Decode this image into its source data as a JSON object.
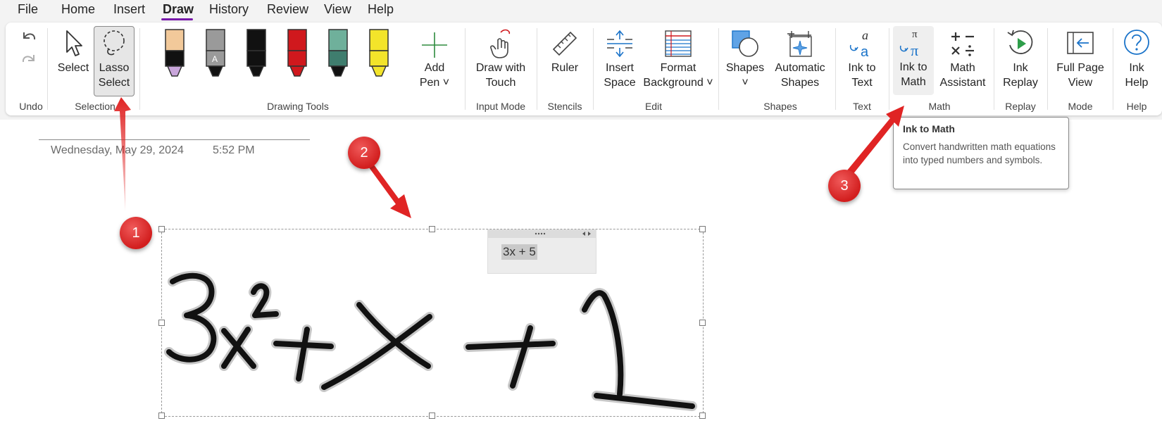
{
  "menu": {
    "items": [
      "File",
      "Home",
      "Insert",
      "Draw",
      "History",
      "Review",
      "View",
      "Help"
    ],
    "active": "Draw"
  },
  "ribbon": {
    "groups": {
      "undo": "Undo",
      "selection": "Selection",
      "drawing_tools": "Drawing Tools",
      "input_mode": "Input Mode",
      "stencils": "Stencils",
      "edit": "Edit",
      "shapes": "Shapes",
      "text": "Text",
      "math": "Math",
      "replay": "Replay",
      "mode": "Mode",
      "help": "Help"
    },
    "buttons": {
      "select": "Select",
      "lasso_1": "Lasso",
      "lasso_2": "Select",
      "add_pen_1": "Add",
      "add_pen_2": "Pen ˅",
      "draw_touch_1": "Draw with",
      "draw_touch_2": "Touch",
      "ruler": "Ruler",
      "insert_space_1": "Insert",
      "insert_space_2": "Space",
      "format_bg_1": "Format",
      "format_bg_2": "Background ˅",
      "shapes_1": "Shapes",
      "shapes_2": "˅",
      "auto_shapes_1": "Automatic",
      "auto_shapes_2": "Shapes",
      "ink_text_1": "Ink to",
      "ink_text_2": "Text",
      "ink_math_1": "Ink to",
      "ink_math_2": "Math",
      "math_assist_1": "Math",
      "math_assist_2": "Assistant",
      "ink_replay_1": "Ink",
      "ink_replay_2": "Replay",
      "full_page_1": "Full Page",
      "full_page_2": "View",
      "ink_help_1": "Ink",
      "ink_help_2": "Help"
    },
    "pens": [
      {
        "body": "#111111",
        "tip": "#f2c99a",
        "base": "#c9a6db"
      },
      {
        "body": "#9a9a9a",
        "tip": "#9a9a9a",
        "base": "#111111",
        "badge": "A"
      },
      {
        "body": "#111111",
        "tip": "#111111",
        "base": "#111111"
      },
      {
        "body": "#d0181d",
        "tip": "#d0181d",
        "base": "#d0181d"
      },
      {
        "body": "#3f7d6e",
        "tip": "#6fb09b",
        "base": "#111111"
      },
      {
        "body": "#f3e42a",
        "tip": "#f3e42a",
        "base": "#f3e42a"
      }
    ],
    "accent": "#7719aa"
  },
  "page": {
    "date": "Wednesday, May 29, 2024",
    "time": "5:52 PM",
    "ink_expression": "3x²+x+1",
    "recognized_math": "3x + 5"
  },
  "tooltip": {
    "title": "Ink to Math",
    "description": "Convert handwritten math equations into typed numbers and symbols."
  },
  "annotations": {
    "badge_1": "1",
    "badge_2": "2",
    "badge_3": "3",
    "color": "#e02424"
  }
}
